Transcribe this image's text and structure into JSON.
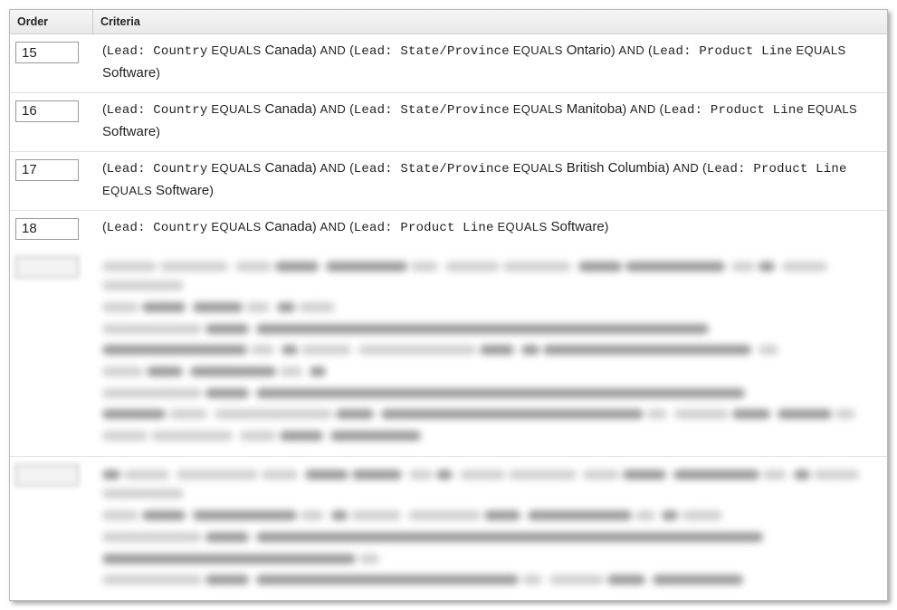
{
  "header": {
    "order": "Order",
    "criteria": "Criteria"
  },
  "labels": {
    "lead": "Lead:",
    "country": "Country",
    "state": "State/Province",
    "product": "Product Line",
    "equals": "EQUALS",
    "and": "AND"
  },
  "rows": [
    {
      "order": "15",
      "state": "Ontario",
      "has_state": true
    },
    {
      "order": "16",
      "state": "Manitoba",
      "has_state": true
    },
    {
      "order": "17",
      "state": "British Columbia",
      "has_state": true
    },
    {
      "order": "18",
      "state": "",
      "has_state": false
    }
  ],
  "country_value": "Canada",
  "product_value": "Software"
}
